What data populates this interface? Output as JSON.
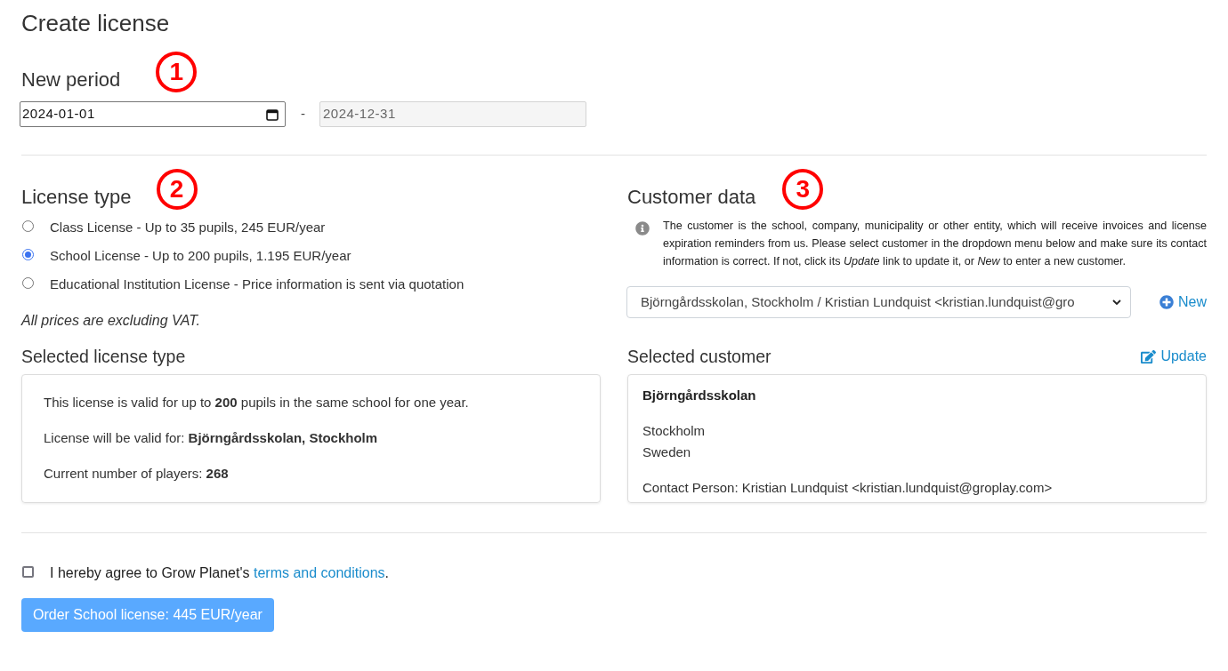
{
  "page_title": "Create license",
  "period": {
    "heading": "New period",
    "marker": "1",
    "start": {
      "value": "2024-01-01",
      "disabled": false
    },
    "separator": "-",
    "end": {
      "value": "2024-12-31",
      "disabled": true
    }
  },
  "license_type": {
    "heading": "License type",
    "marker": "2",
    "options": [
      {
        "label": "Class License - Up to 35 pupils, 245 EUR/year",
        "selected": false
      },
      {
        "label": "School License - Up to 200 pupils, 1.195 EUR/year",
        "selected": true
      },
      {
        "label": "Educational Institution License - Price information is sent via quotation",
        "selected": false
      }
    ],
    "note": "All prices are excluding VAT."
  },
  "customer_data": {
    "heading": "Customer data",
    "marker": "3",
    "info": "The customer is the school, company, municipality or other entity, which will receive invoices and license expiration reminders from us. Please select customer in the dropdown menu below and make sure its contact information is correct. If not, click its *Update* link to update it, or *New* to enter a new customer.",
    "select": {
      "value": "Björngårdsskolan, Stockholm / Kristian Lundquist <kristian.lundquist@gro"
    },
    "new_button": "New"
  },
  "selected_license": {
    "heading": "Selected license type",
    "lines": [
      "This license is valid for up to **200** pupils in the same school for one year.",
      "License will be valid for: **Björngårdsskolan, Stockholm**",
      "Current number of players: **268**"
    ]
  },
  "selected_customer": {
    "heading": "Selected customer",
    "update_link": "Update",
    "name": "Björngårdsskolan",
    "address": [
      "Stockholm",
      "Sweden"
    ],
    "contact": "Contact Person: Kristian Lundquist <kristian.lundquist@groplay.com>"
  },
  "agreement": {
    "checked": false,
    "text": "I hereby agree to Grow Planet's",
    "link": "terms and conditions",
    "after": "."
  },
  "order_button": {
    "label": "Order School license: 445 EUR/year",
    "disabled": true
  }
}
